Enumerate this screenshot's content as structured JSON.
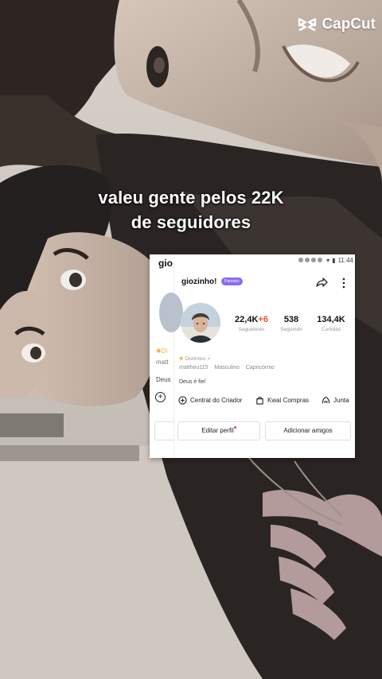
{
  "watermark": {
    "brand": "CapCut",
    "icon": "capcut-logo-icon"
  },
  "caption": {
    "line1": "valeu gente pelos 22K",
    "line2": "de seguidores"
  },
  "profile": {
    "left_strip": {
      "partial_username": "gio",
      "partial_bio": "Di",
      "partial_bio2": "matt",
      "partial_bio3": "Deus"
    },
    "status_bar": {
      "time": "11:44"
    },
    "username": "giozinho!",
    "badge": "Parceiro",
    "stats": {
      "followers": {
        "value": "22,4K",
        "delta": "+6",
        "label": "Seguidores"
      },
      "following": {
        "value": "538",
        "label": "Seguindo"
      },
      "likes": {
        "value": "134,4K",
        "label": "Curtidas"
      }
    },
    "bio": {
      "line1": "Distintivo",
      "line1_suffix": ">",
      "tags": [
        "mattheu115",
        "Masculino",
        "Capricórnio"
      ],
      "line3": "Deus é fiel"
    },
    "quick_actions": {
      "creator": "Central do Criador",
      "shopping": "Kwai Compras",
      "together": "Junta"
    },
    "buttons": {
      "edit": "Editar perfil",
      "add_friends": "Adicionar amigos"
    },
    "accent_color": "#f0502a",
    "badge_color": "#8b6cf0"
  }
}
